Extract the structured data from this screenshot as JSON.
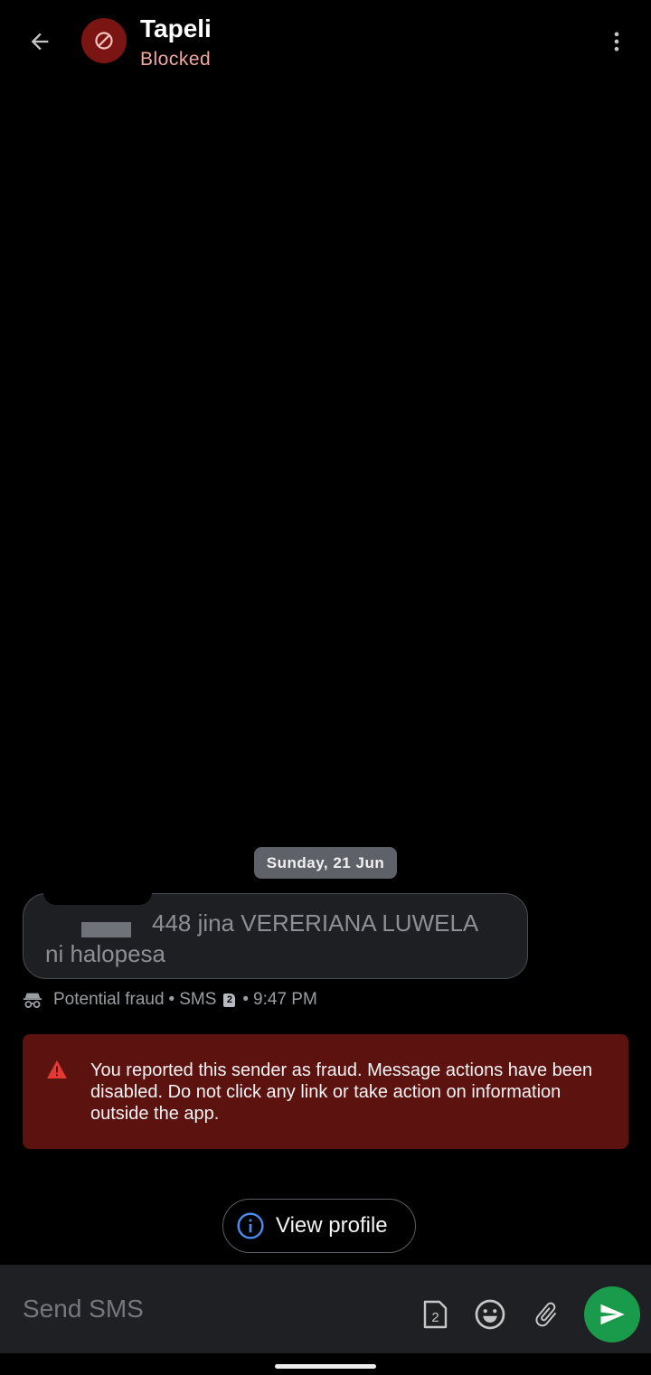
{
  "header": {
    "contact_name": "Tapeli",
    "contact_status": "Blocked",
    "back_icon": "arrow-left-icon",
    "avatar_icon": "block-icon",
    "menu_icon": "more-vert-icon"
  },
  "conversation": {
    "date_chip": "Sunday, 21 Jun",
    "message": {
      "line1": "448 jina VERERIANA LUWELA",
      "line2": "ni halopesa"
    },
    "meta": {
      "label": "Potential fraud",
      "sep1": "•",
      "channel": "SMS",
      "sim": "2",
      "sep2": "•",
      "time": "9:47 PM"
    }
  },
  "fraud_banner": {
    "text": "You reported this sender as fraud. Message actions have been disabled. Do not click any link or take action on information outside the app."
  },
  "profile_button": {
    "label": "View profile"
  },
  "composer": {
    "placeholder": "Send SMS",
    "sim_label": "2"
  },
  "colors": {
    "background": "#000000",
    "blocked_red": "#7a1513",
    "status_pink": "#f2a7a0",
    "banner_red": "#5c120f",
    "send_green": "#1a9b4b",
    "info_blue": "#4c8df6"
  }
}
